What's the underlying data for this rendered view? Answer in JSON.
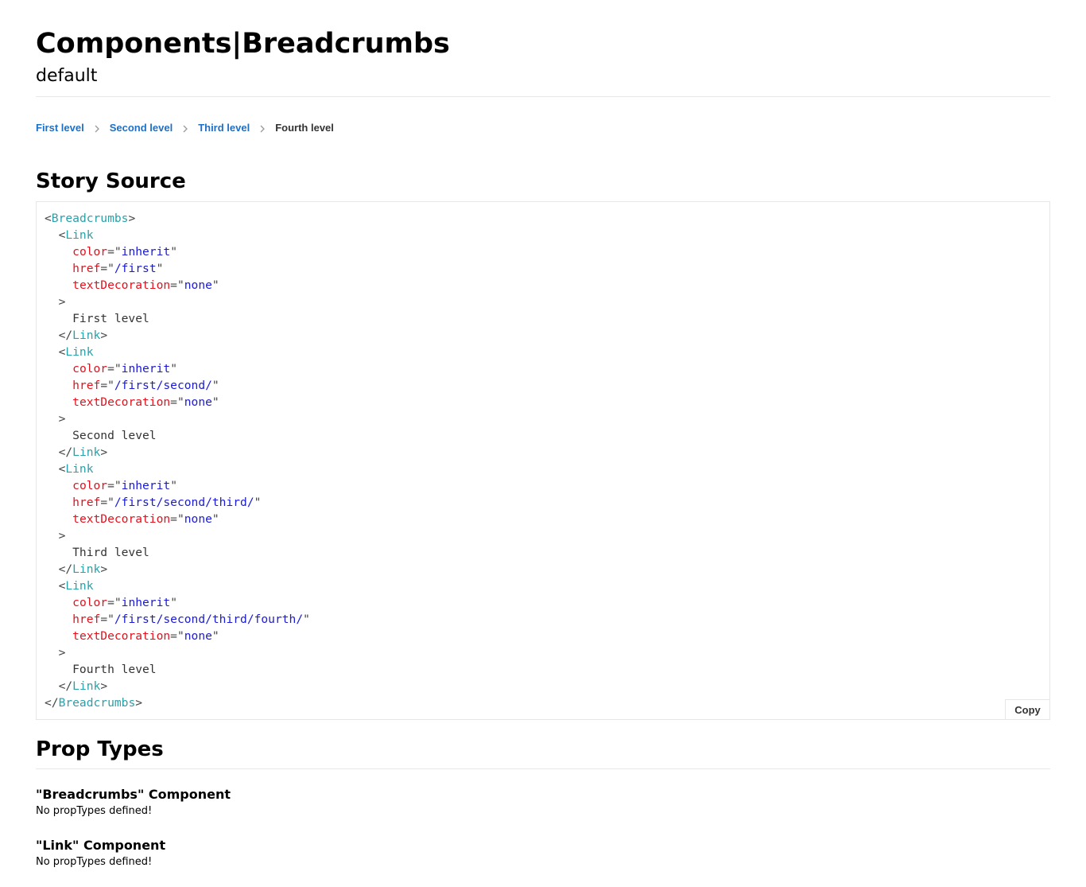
{
  "header": {
    "title": "Components|Breadcrumbs",
    "subtitle": "default"
  },
  "breadcrumbs": {
    "items": [
      {
        "label": "First level"
      },
      {
        "label": "Second level"
      },
      {
        "label": "Third level"
      },
      {
        "label": "Fourth level"
      }
    ],
    "separator_icon": "chevron-right-icon"
  },
  "story_source": {
    "heading": "Story Source",
    "copy_label": "Copy",
    "code_lines": [
      [
        {
          "t": "punc",
          "v": "<"
        },
        {
          "t": "tag",
          "v": "Breadcrumbs"
        },
        {
          "t": "punc",
          "v": ">"
        }
      ],
      [
        {
          "t": "punc",
          "v": "  <"
        },
        {
          "t": "tag",
          "v": "Link"
        }
      ],
      [
        {
          "t": "punc",
          "v": "    "
        },
        {
          "t": "attr",
          "v": "color"
        },
        {
          "t": "punc",
          "v": "=\""
        },
        {
          "t": "val",
          "v": "inherit"
        },
        {
          "t": "punc",
          "v": "\""
        }
      ],
      [
        {
          "t": "punc",
          "v": "    "
        },
        {
          "t": "attr",
          "v": "href"
        },
        {
          "t": "punc",
          "v": "=\""
        },
        {
          "t": "val",
          "v": "/first"
        },
        {
          "t": "punc",
          "v": "\""
        }
      ],
      [
        {
          "t": "punc",
          "v": "    "
        },
        {
          "t": "attr",
          "v": "textDecoration"
        },
        {
          "t": "punc",
          "v": "=\""
        },
        {
          "t": "val",
          "v": "none"
        },
        {
          "t": "punc",
          "v": "\""
        }
      ],
      [
        {
          "t": "punc",
          "v": "  >"
        }
      ],
      [
        {
          "t": "text",
          "v": "    First level"
        }
      ],
      [
        {
          "t": "punc",
          "v": "  </"
        },
        {
          "t": "tag",
          "v": "Link"
        },
        {
          "t": "punc",
          "v": ">"
        }
      ],
      [
        {
          "t": "punc",
          "v": "  <"
        },
        {
          "t": "tag",
          "v": "Link"
        }
      ],
      [
        {
          "t": "punc",
          "v": "    "
        },
        {
          "t": "attr",
          "v": "color"
        },
        {
          "t": "punc",
          "v": "=\""
        },
        {
          "t": "val",
          "v": "inherit"
        },
        {
          "t": "punc",
          "v": "\""
        }
      ],
      [
        {
          "t": "punc",
          "v": "    "
        },
        {
          "t": "attr",
          "v": "href"
        },
        {
          "t": "punc",
          "v": "=\""
        },
        {
          "t": "val",
          "v": "/first/second/"
        },
        {
          "t": "punc",
          "v": "\""
        }
      ],
      [
        {
          "t": "punc",
          "v": "    "
        },
        {
          "t": "attr",
          "v": "textDecoration"
        },
        {
          "t": "punc",
          "v": "=\""
        },
        {
          "t": "val",
          "v": "none"
        },
        {
          "t": "punc",
          "v": "\""
        }
      ],
      [
        {
          "t": "punc",
          "v": "  >"
        }
      ],
      [
        {
          "t": "text",
          "v": "    Second level"
        }
      ],
      [
        {
          "t": "punc",
          "v": "  </"
        },
        {
          "t": "tag",
          "v": "Link"
        },
        {
          "t": "punc",
          "v": ">"
        }
      ],
      [
        {
          "t": "punc",
          "v": "  <"
        },
        {
          "t": "tag",
          "v": "Link"
        }
      ],
      [
        {
          "t": "punc",
          "v": "    "
        },
        {
          "t": "attr",
          "v": "color"
        },
        {
          "t": "punc",
          "v": "=\""
        },
        {
          "t": "val",
          "v": "inherit"
        },
        {
          "t": "punc",
          "v": "\""
        }
      ],
      [
        {
          "t": "punc",
          "v": "    "
        },
        {
          "t": "attr",
          "v": "href"
        },
        {
          "t": "punc",
          "v": "=\""
        },
        {
          "t": "val",
          "v": "/first/second/third/"
        },
        {
          "t": "punc",
          "v": "\""
        }
      ],
      [
        {
          "t": "punc",
          "v": "    "
        },
        {
          "t": "attr",
          "v": "textDecoration"
        },
        {
          "t": "punc",
          "v": "=\""
        },
        {
          "t": "val",
          "v": "none"
        },
        {
          "t": "punc",
          "v": "\""
        }
      ],
      [
        {
          "t": "punc",
          "v": "  >"
        }
      ],
      [
        {
          "t": "text",
          "v": "    Third level"
        }
      ],
      [
        {
          "t": "punc",
          "v": "  </"
        },
        {
          "t": "tag",
          "v": "Link"
        },
        {
          "t": "punc",
          "v": ">"
        }
      ],
      [
        {
          "t": "punc",
          "v": "  <"
        },
        {
          "t": "tag",
          "v": "Link"
        }
      ],
      [
        {
          "t": "punc",
          "v": "    "
        },
        {
          "t": "attr",
          "v": "color"
        },
        {
          "t": "punc",
          "v": "=\""
        },
        {
          "t": "val",
          "v": "inherit"
        },
        {
          "t": "punc",
          "v": "\""
        }
      ],
      [
        {
          "t": "punc",
          "v": "    "
        },
        {
          "t": "attr",
          "v": "href"
        },
        {
          "t": "punc",
          "v": "=\""
        },
        {
          "t": "val",
          "v": "/first/second/third/fourth/"
        },
        {
          "t": "punc",
          "v": "\""
        }
      ],
      [
        {
          "t": "punc",
          "v": "    "
        },
        {
          "t": "attr",
          "v": "textDecoration"
        },
        {
          "t": "punc",
          "v": "=\""
        },
        {
          "t": "val",
          "v": "none"
        },
        {
          "t": "punc",
          "v": "\""
        }
      ],
      [
        {
          "t": "punc",
          "v": "  >"
        }
      ],
      [
        {
          "t": "text",
          "v": "    Fourth level"
        }
      ],
      [
        {
          "t": "punc",
          "v": "  </"
        },
        {
          "t": "tag",
          "v": "Link"
        },
        {
          "t": "punc",
          "v": ">"
        }
      ],
      [
        {
          "t": "punc",
          "v": "</"
        },
        {
          "t": "tag",
          "v": "Breadcrumbs"
        },
        {
          "t": "punc",
          "v": ">"
        }
      ]
    ]
  },
  "prop_types": {
    "heading": "Prop Types",
    "components": [
      {
        "title": "\"Breadcrumbs\" Component",
        "note": "No propTypes defined!"
      },
      {
        "title": "\"Link\" Component",
        "note": "No propTypes defined!"
      }
    ]
  },
  "colors": {
    "link": "#1f6fc3",
    "current_crumb": "#333333",
    "code_tag": "#2aa0a8",
    "code_attr": "#e0121e",
    "code_value": "#1a1ad6"
  }
}
